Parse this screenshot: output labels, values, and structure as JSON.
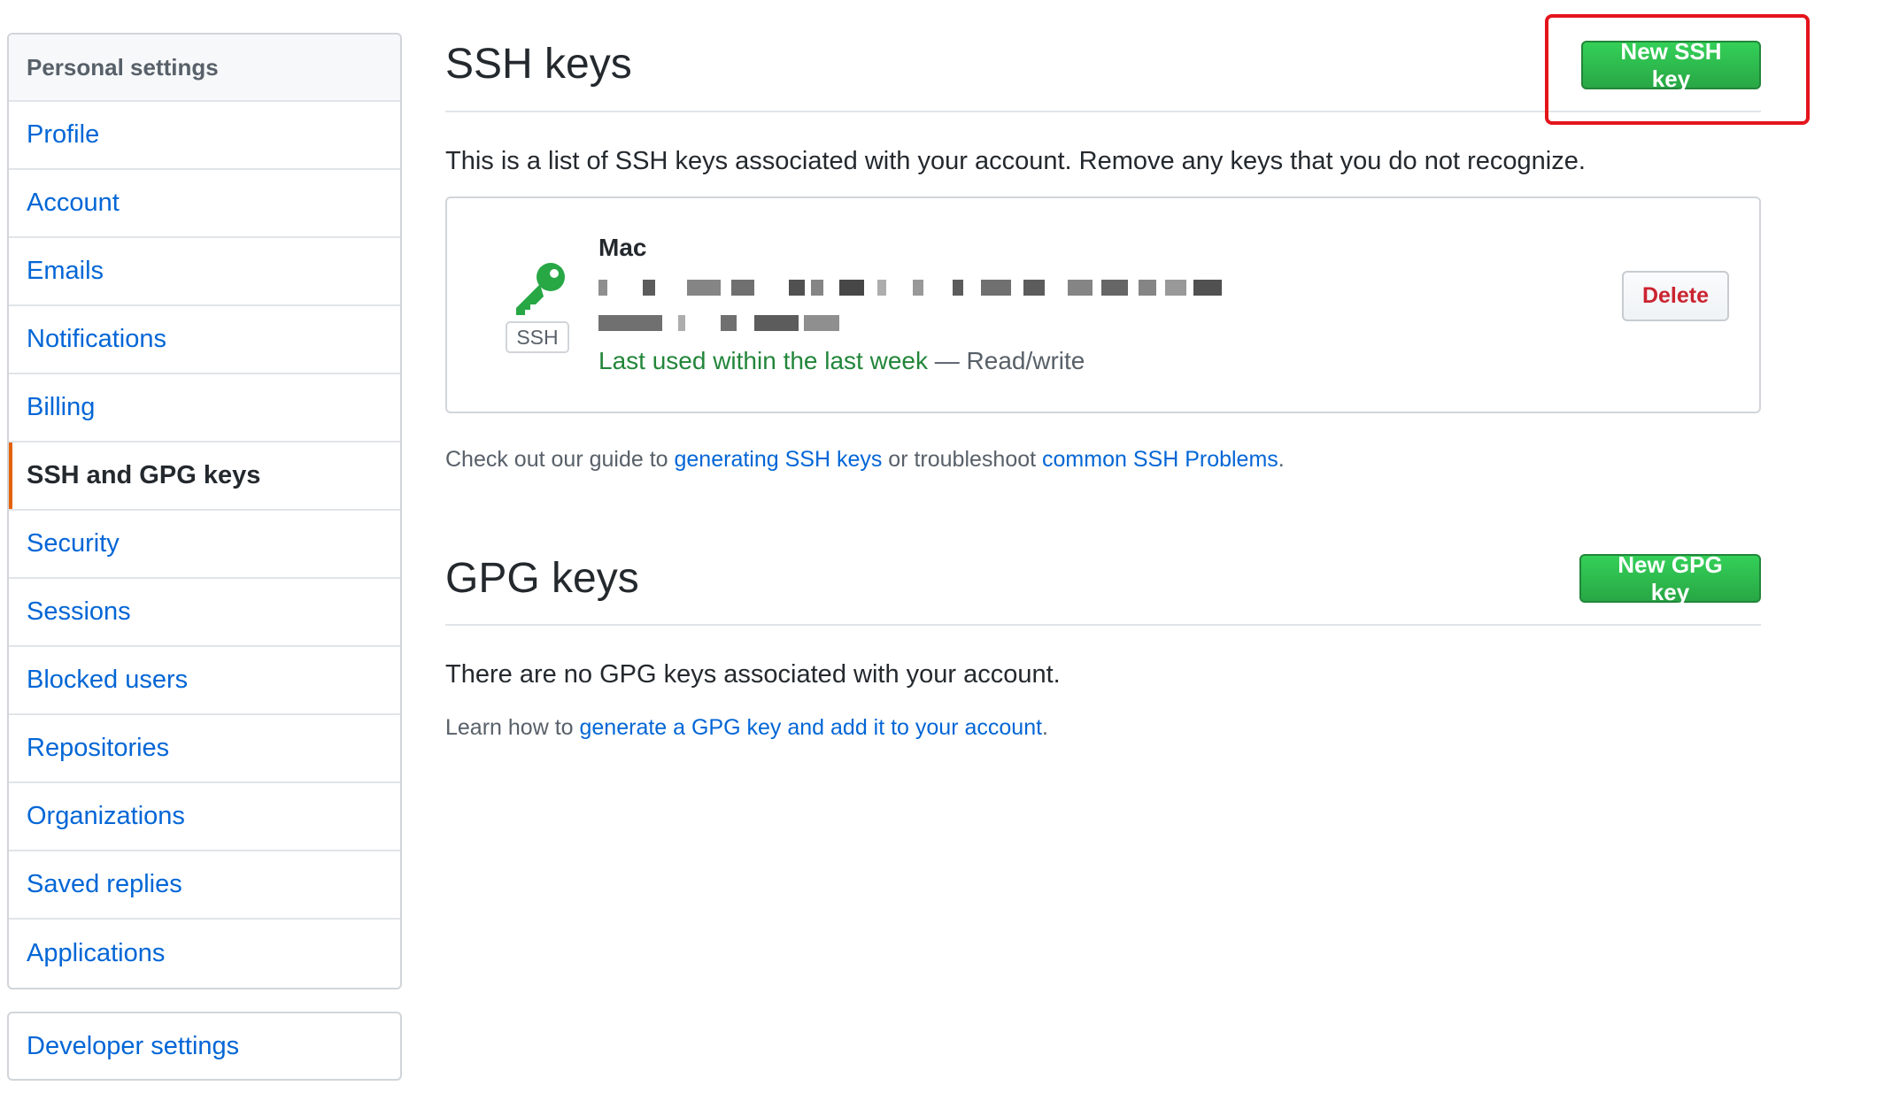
{
  "sidebar": {
    "header": "Personal settings",
    "items": [
      {
        "label": "Profile"
      },
      {
        "label": "Account"
      },
      {
        "label": "Emails"
      },
      {
        "label": "Notifications"
      },
      {
        "label": "Billing"
      },
      {
        "label": "SSH and GPG keys",
        "selected": true
      },
      {
        "label": "Security"
      },
      {
        "label": "Sessions"
      },
      {
        "label": "Blocked users"
      },
      {
        "label": "Repositories"
      },
      {
        "label": "Organizations"
      },
      {
        "label": "Saved replies"
      },
      {
        "label": "Applications"
      }
    ],
    "developer_settings": "Developer settings"
  },
  "ssh": {
    "title": "SSH keys",
    "new_button": "New SSH key",
    "description": "This is a list of SSH keys associated with your account. Remove any keys that you do not recognize.",
    "keys": [
      {
        "name": "Mac",
        "type_label": "SSH",
        "last_used": "Last used within the last week",
        "access": " — Read/write",
        "delete_label": "Delete"
      }
    ],
    "guide": {
      "prefix": "Check out our guide to ",
      "link1": "generating SSH keys",
      "middle": " or troubleshoot ",
      "link2": "common SSH Problems",
      "suffix": "."
    }
  },
  "gpg": {
    "title": "GPG keys",
    "new_button": "New GPG key",
    "empty_message": "There are no GPG keys associated with your account.",
    "learn": {
      "prefix": "Learn how to ",
      "link": "generate a GPG key and add it to your account",
      "suffix": "."
    }
  },
  "colors": {
    "link": "#0366d6",
    "primary_button": "#28a745",
    "danger_text": "#cb2431",
    "selected_indicator": "#e36209",
    "highlight_box": "#e4141b",
    "recent_use": "#22863a"
  },
  "icons": {
    "key": "key-icon"
  }
}
